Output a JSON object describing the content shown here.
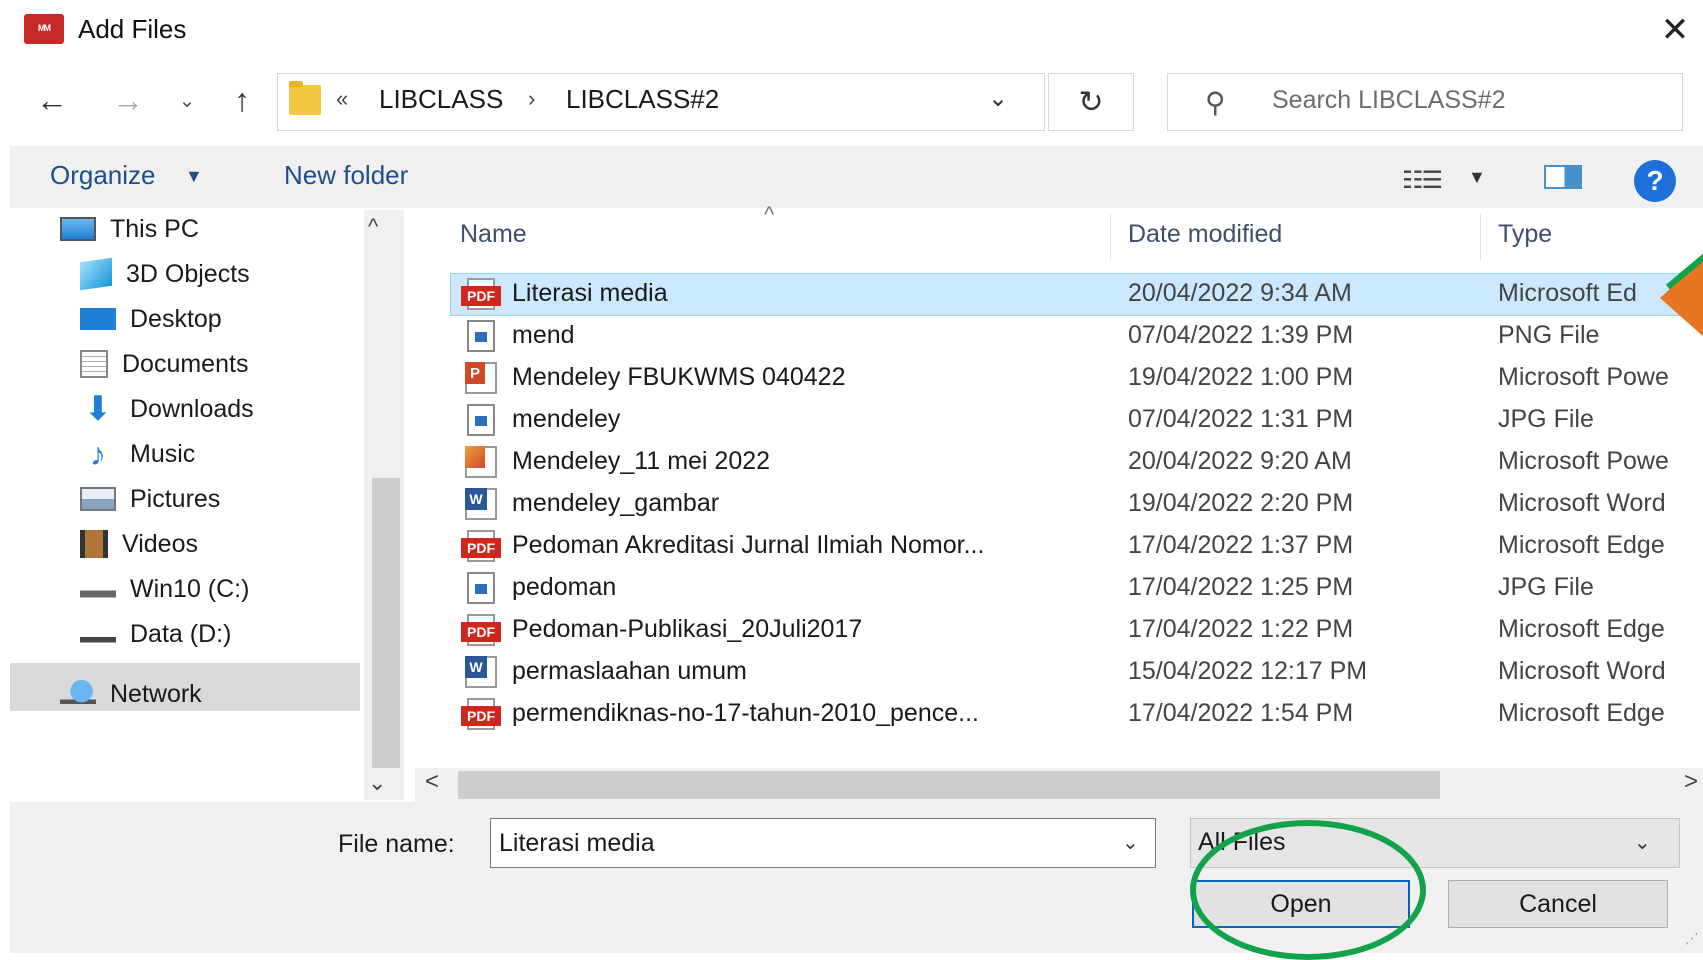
{
  "window": {
    "title": "Add Files",
    "close_glyph": "✕"
  },
  "nav": {
    "back_glyph": "←",
    "forward_glyph": "→",
    "recent_glyph": "⌄",
    "up_glyph": "↑"
  },
  "address": {
    "more_glyph": "«",
    "crumbs": [
      "LIBCLASS",
      "LIBCLASS#2"
    ],
    "separator": "›",
    "dropdown_glyph": "⌄",
    "refresh_glyph": "↻"
  },
  "search": {
    "placeholder": "Search LIBCLASS#2",
    "icon": "search-icon"
  },
  "toolbar": {
    "organize_label": "Organize",
    "organize_caret": "▼",
    "new_folder_label": "New folder",
    "view_caret": "▼",
    "help_label": "?"
  },
  "sidebar": {
    "items": [
      {
        "label": "This PC",
        "icon": "computer-icon"
      },
      {
        "label": "3D Objects",
        "icon": "cube-icon"
      },
      {
        "label": "Desktop",
        "icon": "desktop-icon"
      },
      {
        "label": "Documents",
        "icon": "documents-icon"
      },
      {
        "label": "Downloads",
        "icon": "download-icon"
      },
      {
        "label": "Music",
        "icon": "music-icon"
      },
      {
        "label": "Pictures",
        "icon": "pictures-icon"
      },
      {
        "label": "Videos",
        "icon": "videos-icon"
      },
      {
        "label": "Win10 (C:)",
        "icon": "drive-icon"
      },
      {
        "label": "Data (D:)",
        "icon": "drive-icon"
      },
      {
        "label": "Network",
        "icon": "network-icon"
      }
    ],
    "selected": "Data (D:)"
  },
  "file_list": {
    "columns": [
      "Name",
      "Date modified",
      "Type"
    ],
    "sort_glyph": "^",
    "rows": [
      {
        "name": "Literasi media",
        "date": "20/04/2022 9:34 AM",
        "type": "Microsoft Ed",
        "icon": "pdf-icon",
        "selected": true
      },
      {
        "name": "mend",
        "date": "07/04/2022 1:39 PM",
        "type": "PNG File",
        "icon": "image-icon"
      },
      {
        "name": "Mendeley FBUKWMS 040422",
        "date": "19/04/2022 1:00 PM",
        "type": "Microsoft Powe",
        "icon": "powerpoint-icon"
      },
      {
        "name": "mendeley",
        "date": "07/04/2022 1:31 PM",
        "type": "JPG File",
        "icon": "image-icon"
      },
      {
        "name": "Mendeley_11 mei 2022",
        "date": "20/04/2022 9:20 AM",
        "type": "Microsoft Powe",
        "icon": "powerpoint-show-icon"
      },
      {
        "name": "mendeley_gambar",
        "date": "19/04/2022 2:20 PM",
        "type": "Microsoft Word",
        "icon": "word-icon"
      },
      {
        "name": "Pedoman Akreditasi Jurnal Ilmiah Nomor...",
        "date": "17/04/2022 1:37 PM",
        "type": "Microsoft Edge",
        "icon": "pdf-icon"
      },
      {
        "name": "pedoman",
        "date": "17/04/2022 1:25 PM",
        "type": "JPG File",
        "icon": "image-icon"
      },
      {
        "name": "Pedoman-Publikasi_20Juli2017",
        "date": "17/04/2022 1:22 PM",
        "type": "Microsoft Edge",
        "icon": "pdf-icon"
      },
      {
        "name": "permaslaahan umum",
        "date": "15/04/2022 12:17 PM",
        "type": "Microsoft Word",
        "icon": "word-icon"
      },
      {
        "name": "permendiknas-no-17-tahun-2010_pence...",
        "date": "17/04/2022 1:54 PM",
        "type": "Microsoft Edge",
        "icon": "pdf-icon"
      }
    ]
  },
  "scroll": {
    "up_glyph": "^",
    "down_glyph": "⌄",
    "left_glyph": "<",
    "right_glyph": ">"
  },
  "bottom": {
    "file_name_label": "File name:",
    "file_name_value": "Literasi media",
    "file_name_caret": "⌄",
    "filter_value": "All Files",
    "filter_caret": "⌄",
    "open_label": "Open",
    "cancel_label": "Cancel"
  },
  "colors": {
    "selection": "#cce8ff",
    "accent": "#0067c0",
    "annotation_green": "#12a34a",
    "annotation_orange": "#e6761f",
    "pdf_red": "#d1261d"
  }
}
